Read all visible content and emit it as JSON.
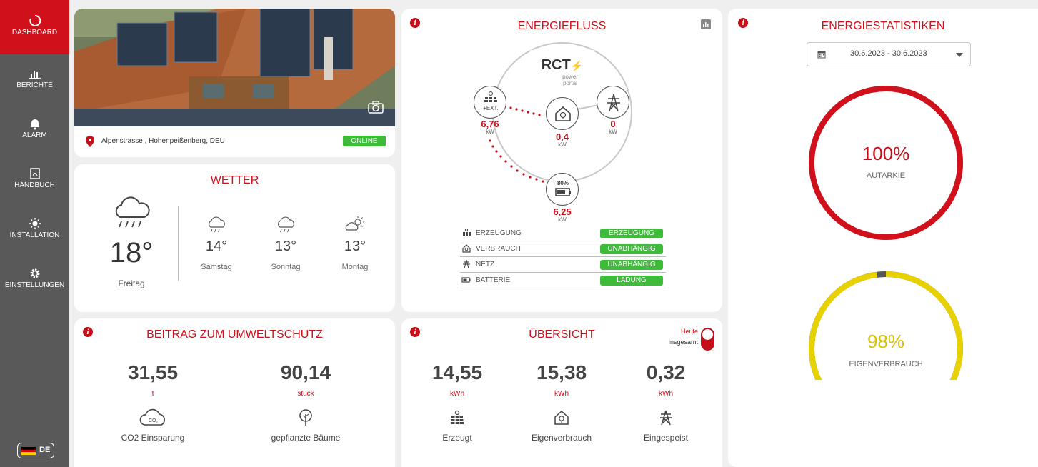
{
  "sidebar": {
    "items": [
      {
        "label": "DASHBOARD",
        "icon": "dashboard-icon"
      },
      {
        "label": "BERICHTE",
        "icon": "chart-icon"
      },
      {
        "label": "ALARM",
        "icon": "bell-icon"
      },
      {
        "label": "HANDBUCH",
        "icon": "pdf-icon"
      },
      {
        "label": "INSTALLATION",
        "icon": "sun-icon"
      },
      {
        "label": "EINSTELLUNGEN",
        "icon": "gear-icon"
      }
    ],
    "language": "DE"
  },
  "location": {
    "address": "Alpenstrasse , Hohenpeißenberg, DEU",
    "status": "ONLINE"
  },
  "weather": {
    "title": "WETTER",
    "today": {
      "temp": "18°",
      "day": "Freitag"
    },
    "forecast": [
      {
        "temp": "14°",
        "day": "Samstag",
        "icon": "rain-cloud-icon"
      },
      {
        "temp": "13°",
        "day": "Sonntag",
        "icon": "rain-cloud-icon"
      },
      {
        "temp": "13°",
        "day": "Montag",
        "icon": "partly-sunny-icon"
      }
    ]
  },
  "energyflow": {
    "title": "ENERGIEFLUSS",
    "logo_main": "RCT",
    "logo_sub1": "power",
    "logo_sub2": "portal",
    "pv": {
      "label": "+EXT.",
      "value": "6,76",
      "unit": "kW"
    },
    "house": {
      "value": "0,4",
      "unit": "kW"
    },
    "grid": {
      "value": "0",
      "unit": "kW"
    },
    "battery": {
      "soc": "80%",
      "value": "6,25",
      "unit": "kW"
    },
    "legend": [
      {
        "label": "ERZEUGUNG",
        "status": "ERZEUGUNG",
        "icon": "solar-panel-icon"
      },
      {
        "label": "VERBRAUCH",
        "status": "UNABHÄNGIG",
        "icon": "house-icon"
      },
      {
        "label": "NETZ",
        "status": "UNABHÄNGIG",
        "icon": "power-tower-icon"
      },
      {
        "label": "BATTERIE",
        "status": "LADUNG",
        "icon": "battery-icon"
      }
    ]
  },
  "stats": {
    "title": "ENERGIESTATISTIKEN",
    "date_range": "30.6.2023 - 30.6.2023",
    "autarkie": {
      "value": "100%",
      "label": "AUTARKIE",
      "fraction": 1.0,
      "color": "#d0101b"
    },
    "eigen": {
      "value": "98%",
      "label": "EIGENVERBRAUCH",
      "fraction": 0.98,
      "color": "#e8d100"
    }
  },
  "environment": {
    "title": "BEITRAG ZUM UMWELTSCHUTZ",
    "items": [
      {
        "value": "31,55",
        "unit": "t",
        "label": "CO2 Einsparung",
        "icon": "co2-cloud-icon"
      },
      {
        "value": "90,14",
        "unit": "stück",
        "label": "gepflanzte Bäume",
        "icon": "tree-icon"
      }
    ]
  },
  "overview": {
    "title": "ÜBERSICHT",
    "toggle_on": "Heute",
    "toggle_off": "Insgesamt",
    "items": [
      {
        "value": "14,55",
        "unit": "kWh",
        "label": "Erzeugt",
        "icon": "solar-panel-icon"
      },
      {
        "value": "15,38",
        "unit": "kWh",
        "label": "Eigenverbrauch",
        "icon": "house-icon"
      },
      {
        "value": "0,32",
        "unit": "kWh",
        "label": "Eingespeist",
        "icon": "power-tower-icon"
      }
    ]
  },
  "colors": {
    "brand": "#d0101b",
    "online": "#3fbb3a",
    "sidebar": "#595959"
  }
}
